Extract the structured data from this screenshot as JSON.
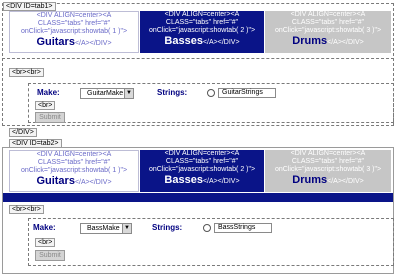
{
  "sections": [
    {
      "div_open_tag": "<DIV ID=tab1>",
      "tabs": [
        {
          "code_lines": [
            "<DIV ALIGN=center><A",
            "CLASS=\"tabs\" href=\"#\"",
            "onClick=\"javascript:showtab( 1 )\">"
          ],
          "label": "Guitars",
          "close_tags": "</A></DIV>",
          "state": "normal"
        },
        {
          "code_lines": [
            "<DIV ALIGN=center><A",
            "CLASS=\"tabs\" href=\"#\"",
            "onClick=\"javascript:showtab( 2 )\">"
          ],
          "label": "Basses",
          "close_tags": "</A></DIV>",
          "state": "selected"
        },
        {
          "code_lines": [
            "<DIV ALIGN=center><A",
            "CLASS=\"tabs\" href=\"#\"",
            "onClick=\"javascript:showtab( 3 )\">"
          ],
          "label": "Drums",
          "close_tags": "</A></DIV>",
          "state": "inactive"
        }
      ],
      "br_tag": "<br><br>",
      "make_label": "Make:",
      "make_select": "GuitarMake",
      "strings_label": "Strings:",
      "strings_value": "GuitarStrings",
      "inner_br": "<br>",
      "submit_label": "Submit",
      "div_close_tag": "</DIV>"
    },
    {
      "div_open_tag": "<DIV ID=tab2>",
      "tabs": [
        {
          "code_lines": [
            "<DIV ALIGN=center><A",
            "CLASS=\"tabs\" href=\"#\"",
            "onClick=\"javascript:showtab( 1 )\">"
          ],
          "label": "Guitars",
          "close_tags": "</A></DIV>",
          "state": "normal"
        },
        {
          "code_lines": [
            "<DIV ALIGN=center><A",
            "CLASS=\"tabs\" href=\"#\"",
            "onClick=\"javascript:showtab( 2 )\">"
          ],
          "label": "Basses",
          "close_tags": "</A></DIV>",
          "state": "selected"
        },
        {
          "code_lines": [
            "<DIV ALIGN=center><A",
            "CLASS=\"tabs\" href=\"#\"",
            "onClick=\"javascript:showtab( 3 )\">"
          ],
          "label": "Drums",
          "close_tags": "</A></DIV>",
          "state": "inactive"
        }
      ],
      "br_tag": "<br><br>",
      "make_label": "Make:",
      "make_select": "BassMake",
      "strings_label": "Strings:",
      "strings_value": "BassStrings",
      "inner_br": "<br>",
      "submit_label": "Submit"
    }
  ],
  "colors": {
    "selected_tab": "#0a1488",
    "label_blue": "#000080",
    "inactive_tab": "#c6c6c6"
  }
}
